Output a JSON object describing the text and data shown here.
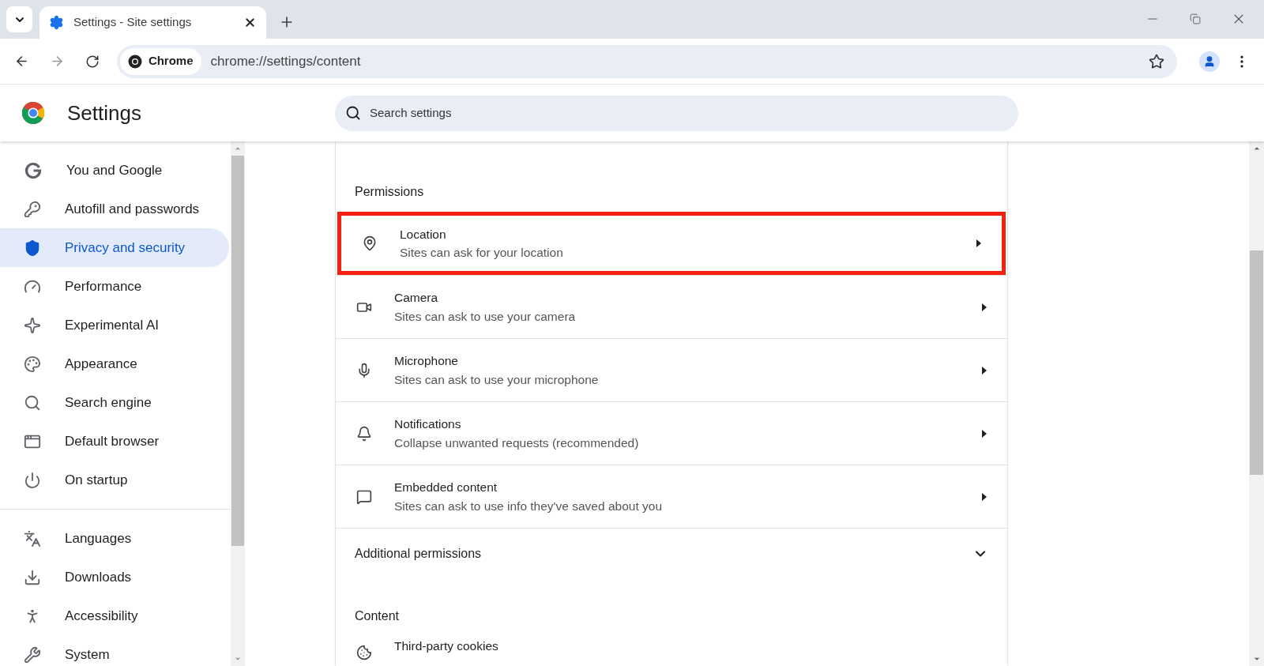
{
  "tabs": [
    {
      "title": "Settings - Site settings",
      "selected": true
    }
  ],
  "toolbar": {
    "chip": "Chrome",
    "url": "chrome://settings/content"
  },
  "header": {
    "title": "Settings",
    "search": {
      "placeholder": "Search settings"
    }
  },
  "sidebar": {
    "groups": [
      [
        {
          "label": "You and Google",
          "selected": false
        },
        {
          "label": "Autofill and passwords",
          "selected": false
        },
        {
          "label": "Privacy and security",
          "selected": true
        },
        {
          "label": "Performance",
          "selected": false
        },
        {
          "label": "Experimental AI",
          "selected": false
        },
        {
          "label": "Appearance",
          "selected": false
        },
        {
          "label": "Search engine",
          "selected": false
        },
        {
          "label": "Default browser",
          "selected": false
        },
        {
          "label": "On startup",
          "selected": false
        }
      ],
      [
        {
          "label": "Languages",
          "selected": false
        },
        {
          "label": "Downloads",
          "selected": false
        },
        {
          "label": "Accessibility",
          "selected": false
        },
        {
          "label": "System",
          "selected": false
        }
      ]
    ]
  },
  "permissions": {
    "heading": "Permissions",
    "rows": [
      {
        "title": "Location",
        "subtitle": "Sites can ask for your location",
        "highlighted": true
      },
      {
        "title": "Camera",
        "subtitle": "Sites can ask to use your camera",
        "highlighted": false
      },
      {
        "title": "Microphone",
        "subtitle": "Sites can ask to use your microphone",
        "highlighted": false
      },
      {
        "title": "Notifications",
        "subtitle": "Collapse unwanted requests (recommended)",
        "highlighted": false
      },
      {
        "title": "Embedded content",
        "subtitle": "Sites can ask to use info they've saved about you",
        "highlighted": false
      }
    ],
    "additional": {
      "label": "Additional permissions",
      "expanded": false
    }
  },
  "content": {
    "heading": "Content",
    "rows": [
      {
        "title": "Third-party cookies"
      }
    ]
  }
}
